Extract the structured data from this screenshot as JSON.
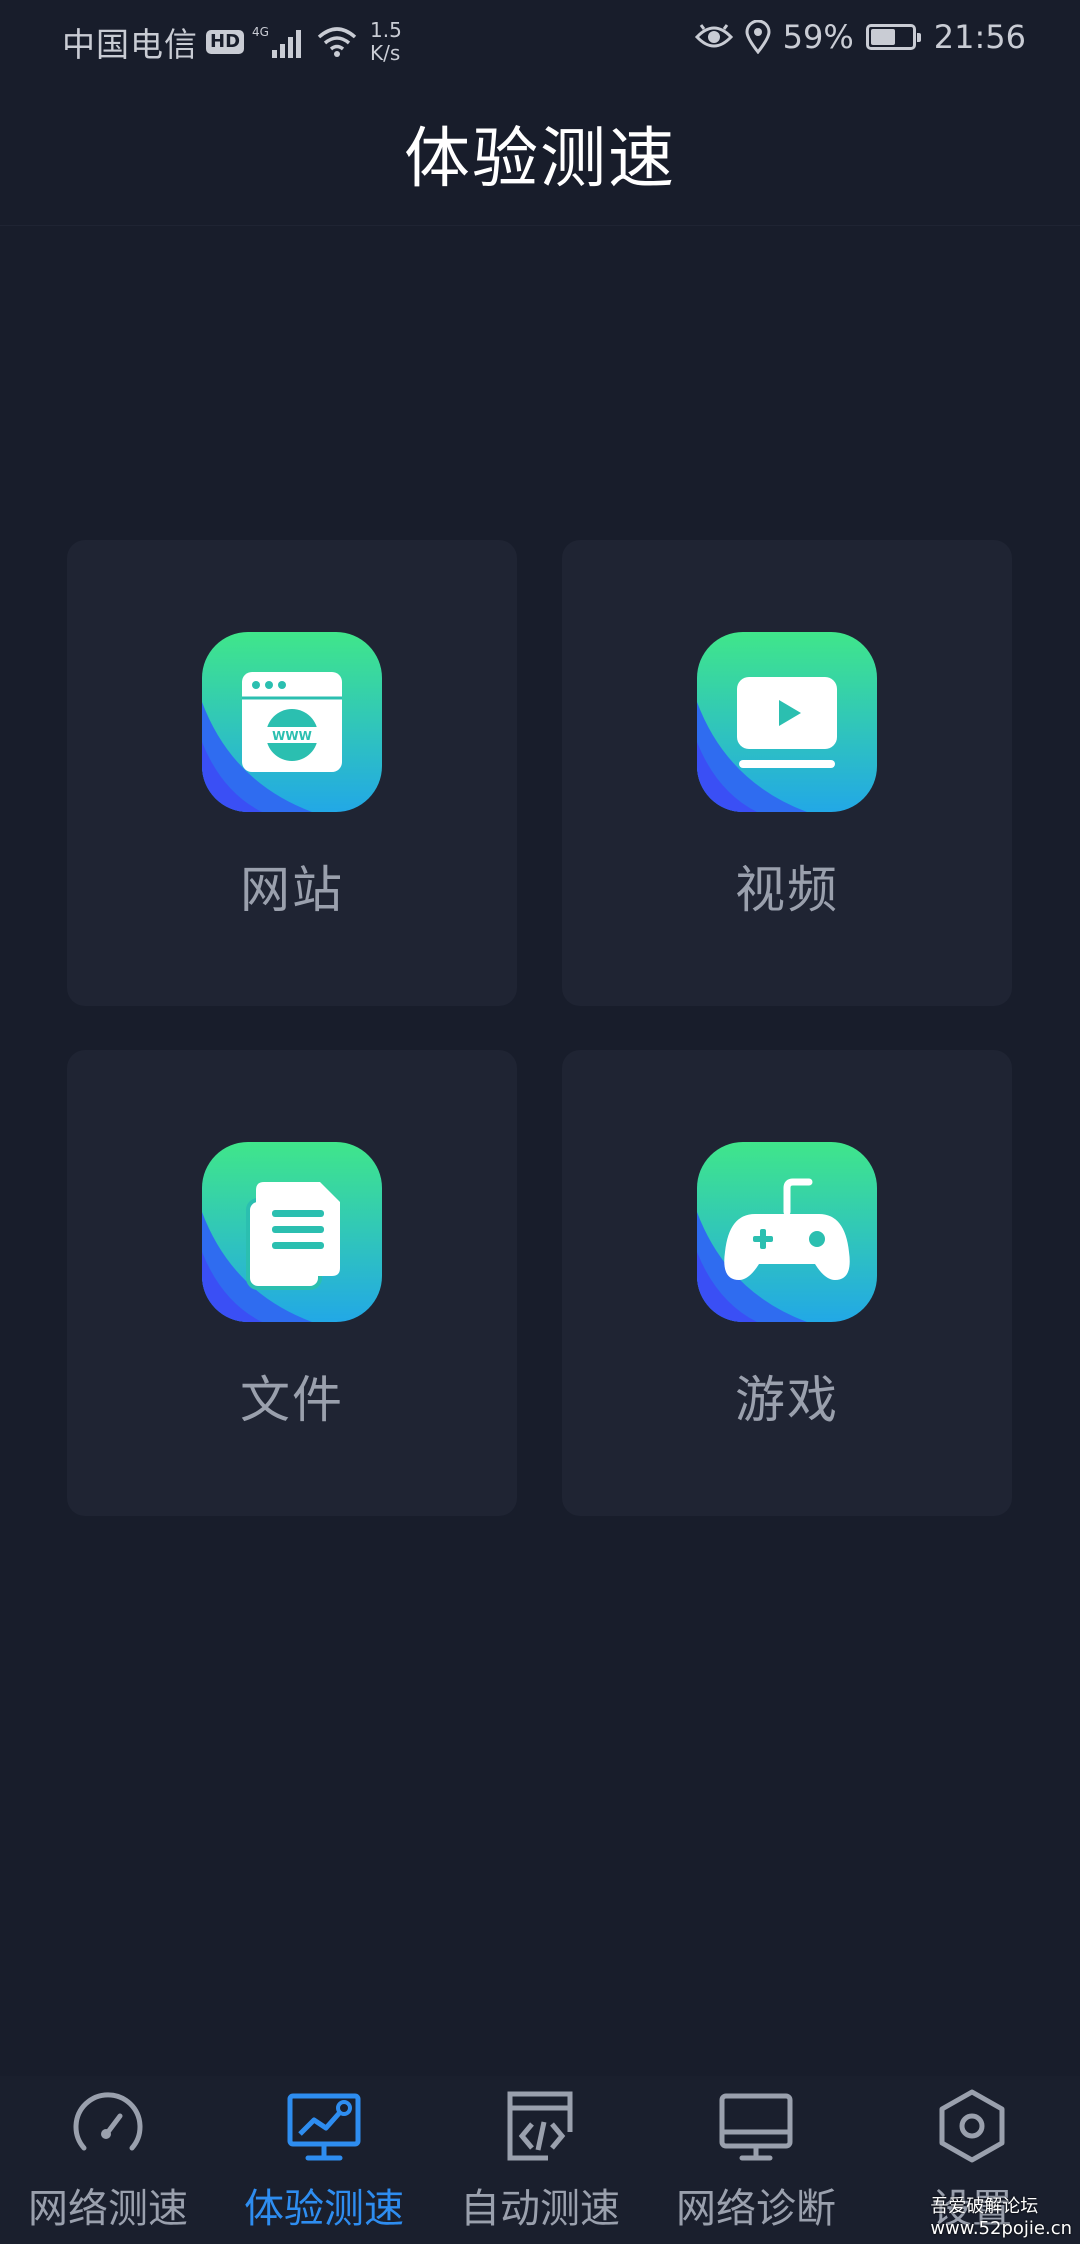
{
  "status_bar": {
    "carrier": "中国电信",
    "hd": "HD",
    "network_type": "4G",
    "speed_value": "1.5",
    "speed_unit": "K/s",
    "battery_percent": "59%",
    "battery_level": 0.59,
    "time": "21:56"
  },
  "header": {
    "title": "体验测速"
  },
  "cards": [
    {
      "label": "网站",
      "icon": "website-icon"
    },
    {
      "label": "视频",
      "icon": "video-icon"
    },
    {
      "label": "文件",
      "icon": "file-icon"
    },
    {
      "label": "游戏",
      "icon": "game-icon"
    }
  ],
  "bottom_nav": {
    "active_index": 1,
    "items": [
      {
        "label": "网络测速",
        "icon": "speedometer-icon"
      },
      {
        "label": "体验测速",
        "icon": "chart-monitor-icon"
      },
      {
        "label": "自动测速",
        "icon": "code-window-icon"
      },
      {
        "label": "网络诊断",
        "icon": "monitor-icon"
      },
      {
        "label": "设置",
        "icon": "hexagon-settings-icon"
      }
    ]
  },
  "watermark": {
    "line1": "吾爱破解论坛",
    "line2": "www.52pojie.cn"
  },
  "colors": {
    "background": "#181d2b",
    "card": "#1f2433",
    "accent": "#2e8df0",
    "icon_gradient_start": "#3ee38e",
    "icon_gradient_end": "#2a7bf0"
  }
}
